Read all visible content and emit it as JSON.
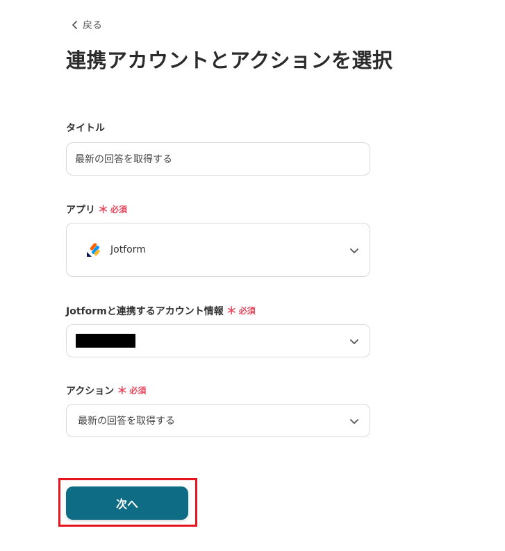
{
  "nav": {
    "back_label": "戻る"
  },
  "page": {
    "title": "連携アカウントとアクションを選択"
  },
  "form": {
    "title_field": {
      "label": "タイトル",
      "value": "最新の回答を取得する"
    },
    "app_field": {
      "label": "アプリ",
      "required_mark": "＊",
      "required_text": "必須",
      "value": "Jotform",
      "icon": "jotform-logo-icon"
    },
    "account_field": {
      "label": "Jotformと連携するアカウント情報",
      "required_mark": "＊",
      "required_text": "必須",
      "value_redacted": true
    },
    "action_field": {
      "label": "アクション",
      "required_mark": "＊",
      "required_text": "必須",
      "value": "最新の回答を取得する"
    }
  },
  "actions": {
    "next_label": "次へ"
  },
  "colors": {
    "primary_button": "#0e6c85",
    "required": "#e8495f",
    "highlight": "#e5141f",
    "border": "#d9d9d9"
  }
}
